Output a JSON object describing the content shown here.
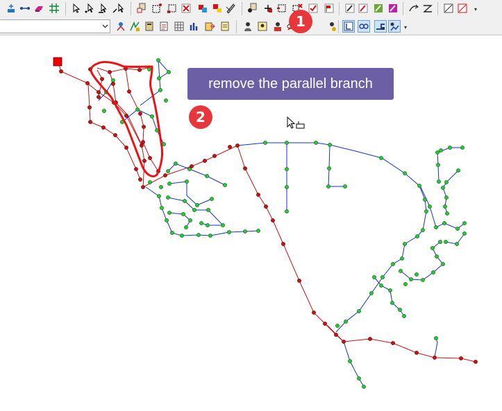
{
  "toolbar_row1": {
    "icons": [
      "add-node-icon",
      "add-pipe-icon",
      "add-valve-icon",
      "grid-icon",
      "select-icon",
      "select-node-icon",
      "select-pipe-icon",
      "select-valve-icon",
      "node-table-icon",
      "select-box-icon",
      "select-box-alt-icon",
      "delete-icon",
      "copy-icon",
      "paste-icon",
      "edit-attributes-icon",
      "node-info-icon",
      "move-node-icon",
      "move-selection-icon",
      "delete-selection-icon",
      "check-icon",
      "flag-icon",
      "edit-icon",
      "edit-alt-icon",
      "color-edit-icon",
      "validate-icon",
      "pipe-arrow-icon",
      "pipe-curve-icon",
      "zoom-box-icon",
      "zoom-box-alt-icon"
    ]
  },
  "toolbar_row2": {
    "combo_value": "",
    "icons": [
      "network-icon",
      "analysis-icon",
      "calc-icon",
      "report-icon",
      "table-icon",
      "chart-icon",
      "export-icon",
      "document-icon",
      "person-icon",
      "person-card-icon",
      "person-alt-icon",
      "hide-icon",
      "person-gear-icon",
      "branch-view-icon",
      "link-icon",
      "pipe-tool-icon",
      "route-icon"
    ]
  },
  "annotations": {
    "step1_number": "1",
    "step2_number": "2",
    "callout_text": "remove the parallel branch"
  },
  "colors": {
    "badge": "#e8373b",
    "callout_bg": "#6c5fa6",
    "highlight": "#ee1111",
    "pipe_red": "#cc1111",
    "pipe_blue": "#1133cc",
    "node_green": "#22cc33",
    "node_red": "#cc1111",
    "source_node": "#ee0000"
  }
}
